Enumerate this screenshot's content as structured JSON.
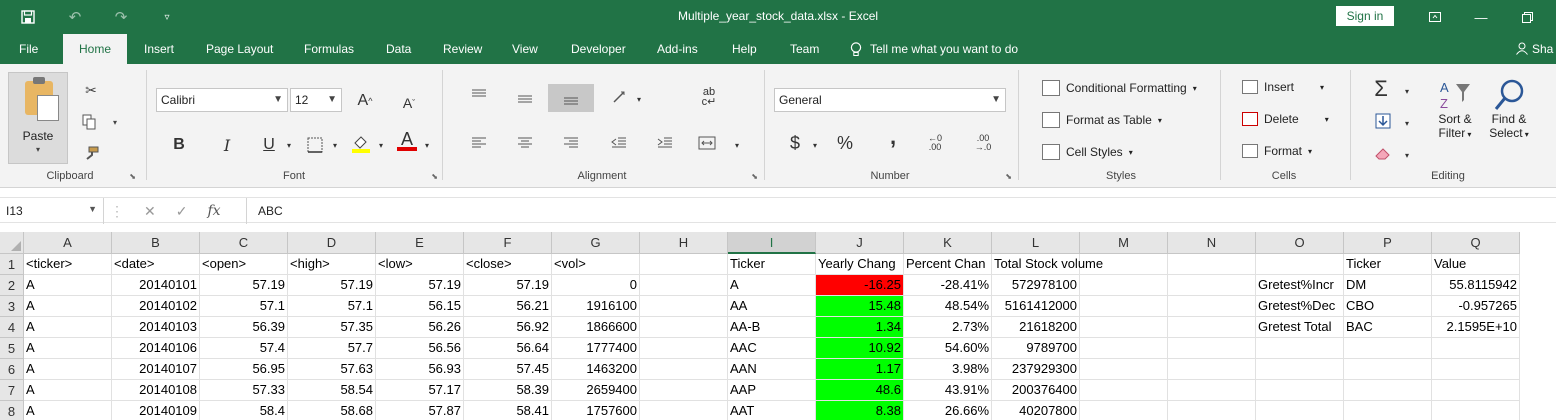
{
  "window": {
    "title": "Multiple_year_stock_data.xlsx  -  Excel",
    "sign_in": "Sign in",
    "user_initial": "Sha",
    "accent": "#217346"
  },
  "ribbon_tabs": [
    "File",
    "Home",
    "Insert",
    "Page Layout",
    "Formulas",
    "Data",
    "Review",
    "View",
    "Developer",
    "Add-ins",
    "Help",
    "Team"
  ],
  "tell_me": "Tell me what you want to do",
  "ribbon": {
    "clipboard": {
      "paste": "Paste",
      "group": "Clipboard"
    },
    "font": {
      "name": "Calibri",
      "size": "12",
      "group": "Font",
      "bold": "B",
      "italic": "I",
      "underline": "U"
    },
    "alignment": {
      "group": "Alignment"
    },
    "number": {
      "format": "General",
      "group": "Number",
      "currency": "$",
      "percent": "%",
      "comma": ","
    },
    "styles": {
      "conditional": "Conditional Formatting",
      "format_table": "Format as Table",
      "cell_styles": "Cell Styles",
      "group": "Styles"
    },
    "cells": {
      "insert": "Insert",
      "delete": "Delete",
      "format": "Format",
      "group": "Cells"
    },
    "editing": {
      "sort": "Sort &",
      "sort2": "Filter",
      "find": "Find &",
      "find2": "Select",
      "group": "Editing"
    }
  },
  "formula_bar": {
    "name_box": "I13",
    "content": "ABC"
  },
  "columns": [
    "A",
    "B",
    "C",
    "D",
    "E",
    "F",
    "G",
    "H",
    "I",
    "J",
    "K",
    "L",
    "M",
    "N",
    "O",
    "P",
    "Q"
  ],
  "selected_column": "I",
  "rows": [
    {
      "n": "1",
      "cells": [
        "<ticker>",
        "<date>",
        "<open>",
        "<high>",
        "<low>",
        "<close>",
        "<vol>",
        "",
        "Ticker",
        "Yearly Chang",
        "Percent Chan",
        "Total Stock volume",
        "",
        "",
        "",
        "Ticker",
        "Value"
      ]
    },
    {
      "n": "2",
      "cells": [
        "A",
        "20140101",
        "57.19",
        "57.19",
        "57.19",
        "57.19",
        "0",
        "",
        "A",
        "-16.25",
        "-28.41%",
        "572978100",
        "",
        "",
        "Gretest%Incr",
        "DM",
        "55.8115942"
      ]
    },
    {
      "n": "3",
      "cells": [
        "A",
        "20140102",
        "57.1",
        "57.1",
        "56.15",
        "56.21",
        "1916100",
        "",
        "AA",
        "15.48",
        "48.54%",
        "5161412000",
        "",
        "",
        "Gretest%Dec",
        "CBO",
        "-0.957265"
      ]
    },
    {
      "n": "4",
      "cells": [
        "A",
        "20140103",
        "56.39",
        "57.35",
        "56.26",
        "56.92",
        "1866600",
        "",
        "AA-B",
        "1.34",
        "2.73%",
        "21618200",
        "",
        "",
        "Gretest Total",
        "BAC",
        "2.1595E+10"
      ]
    },
    {
      "n": "5",
      "cells": [
        "A",
        "20140106",
        "57.4",
        "57.7",
        "56.56",
        "56.64",
        "1777400",
        "",
        "AAC",
        "10.92",
        "54.60%",
        "9789700",
        "",
        "",
        "",
        "",
        ""
      ]
    },
    {
      "n": "6",
      "cells": [
        "A",
        "20140107",
        "56.95",
        "57.63",
        "56.93",
        "57.45",
        "1463200",
        "",
        "AAN",
        "1.17",
        "3.98%",
        "237929300",
        "",
        "",
        "",
        "",
        ""
      ]
    },
    {
      "n": "7",
      "cells": [
        "A",
        "20140108",
        "57.33",
        "58.54",
        "57.17",
        "58.39",
        "2659400",
        "",
        "AAP",
        "48.6",
        "43.91%",
        "200376400",
        "",
        "",
        "",
        "",
        ""
      ]
    },
    {
      "n": "8",
      "cells": [
        "A",
        "20140109",
        "58.4",
        "58.68",
        "57.87",
        "58.41",
        "1757600",
        "",
        "AAT",
        "8.38",
        "26.66%",
        "40207800",
        "",
        "",
        "",
        "",
        ""
      ]
    }
  ],
  "colors": {
    "negative": "#ff0000",
    "positive": "#00ff00"
  }
}
